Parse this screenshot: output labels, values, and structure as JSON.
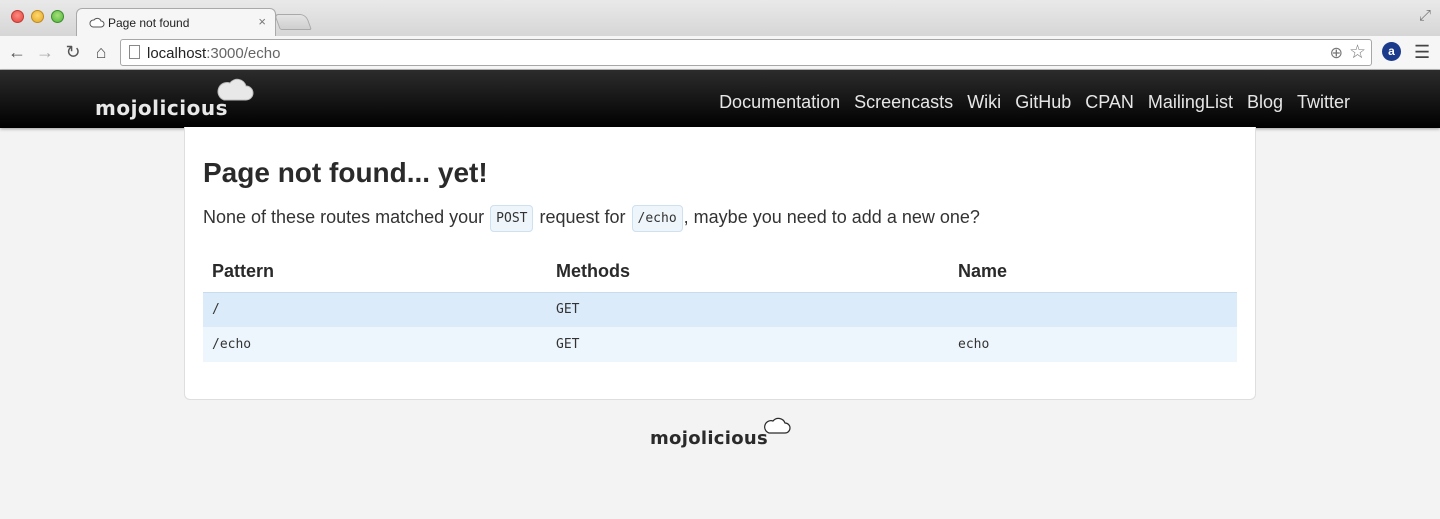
{
  "browser": {
    "tab_title": "Page not found",
    "tab_close": "×",
    "url_host": "localhost",
    "url_rest": ":3000/echo",
    "icons": {
      "back": "←",
      "forward": "→",
      "reload": "↻",
      "home": "⌂",
      "zoom": "⊕",
      "star": "☆",
      "menu": "☰",
      "fullscreen": "⤢",
      "extension": "a"
    }
  },
  "header": {
    "logo_text": "mojolicious",
    "nav": [
      "Documentation",
      "Screencasts",
      "Wiki",
      "GitHub",
      "CPAN",
      "MailingList",
      "Blog",
      "Twitter"
    ]
  },
  "main": {
    "title": "Page not found... yet!",
    "message": {
      "before": "None of these routes matched your ",
      "method": "POST",
      "middle": " request for ",
      "path": "/echo",
      "after": ", maybe you need to add a new one?"
    },
    "table": {
      "headers": [
        "Pattern",
        "Methods",
        "Name"
      ],
      "rows": [
        [
          "/",
          "GET",
          ""
        ],
        [
          "/echo",
          "GET",
          "echo"
        ]
      ]
    }
  },
  "footer": {
    "logo_text": "mojolicious"
  },
  "colors": {
    "header_bg": "#000000",
    "row_highlight": "#dcebfa",
    "row_alt": "#eef6fd",
    "code_bg": "#eef5fb"
  }
}
